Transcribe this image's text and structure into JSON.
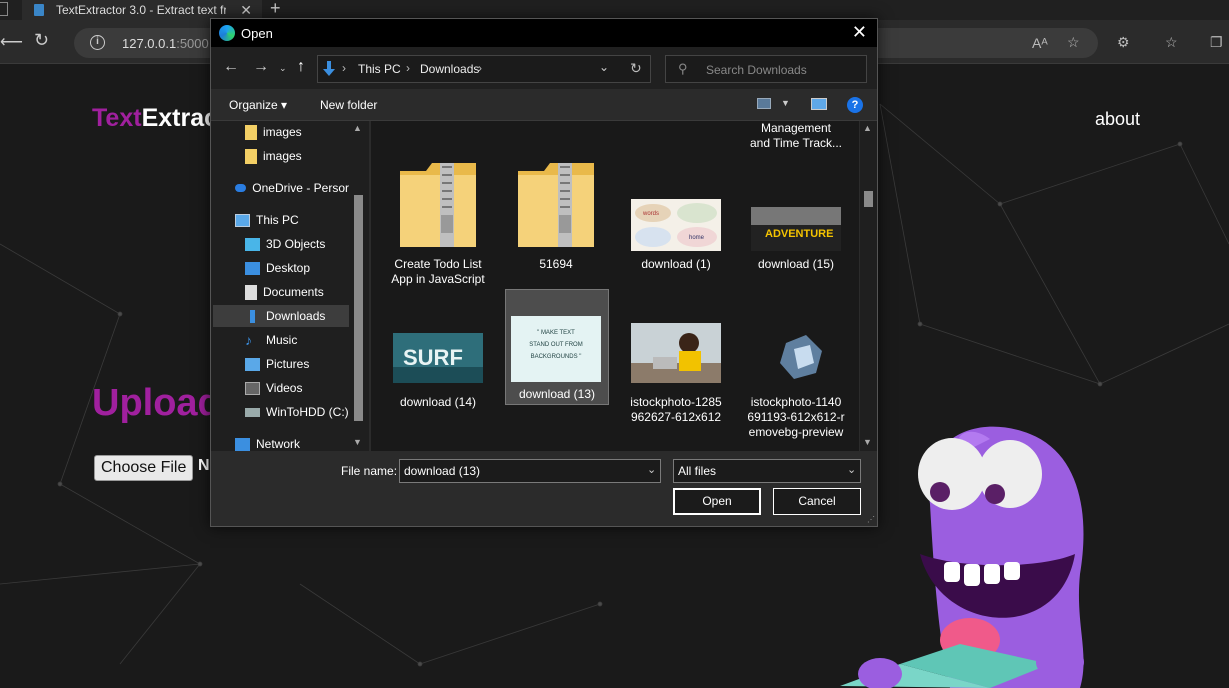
{
  "browser": {
    "tab_title": "TextExtractor 3.0 - Extract text fro",
    "tab_close": "✕",
    "new_tab": "+",
    "address_host": "127.0.0.1",
    "address_port": ":5000"
  },
  "page": {
    "brand_part1": "Text",
    "brand_part2": "Extrac",
    "nav_about": "about",
    "upload_heading": "Upload",
    "choose_file_label": "Choose File",
    "no_file_text": "N"
  },
  "dialog": {
    "title": "Open",
    "close": "✕",
    "breadcrumbs": [
      "This PC",
      "Downloads"
    ],
    "search_placeholder": "Search Downloads",
    "organize_label": "Organize ▾",
    "new_folder_label": "New folder",
    "help": "?",
    "nav_items": [
      {
        "label": "images",
        "icon": "folder-icon"
      },
      {
        "label": "images",
        "icon": "folder-icon"
      },
      {
        "label": "OneDrive - Persor",
        "icon": "onedrive-icon"
      },
      {
        "label": "This PC",
        "icon": "pc-icon"
      },
      {
        "label": "3D Objects",
        "icon": "3d-objects-icon"
      },
      {
        "label": "Desktop",
        "icon": "desktop-icon"
      },
      {
        "label": "Documents",
        "icon": "documents-icon"
      },
      {
        "label": "Downloads",
        "icon": "downloads-icon",
        "selected": true
      },
      {
        "label": "Music",
        "icon": "music-icon"
      },
      {
        "label": "Pictures",
        "icon": "pictures-icon"
      },
      {
        "label": "Videos",
        "icon": "videos-icon"
      },
      {
        "label": "WinToHDD (C:)",
        "icon": "drive-icon"
      },
      {
        "label": "Network",
        "icon": "network-icon"
      }
    ],
    "files_top_partial": "Management\nand Time Track...",
    "files": [
      {
        "name": "Create Todo List\nApp in JavaScript",
        "type": "zip"
      },
      {
        "name": "51694",
        "type": "zip"
      },
      {
        "name": "download (1)",
        "type": "image"
      },
      {
        "name": "download (15)",
        "type": "image",
        "thumb_text": "ADVENTURE"
      },
      {
        "name": "download (14)",
        "type": "image",
        "thumb_text": "SURF"
      },
      {
        "name": "download (13)",
        "type": "image",
        "selected": true,
        "thumb_text": "\" MAKE TEXT STAND OUT FROM BACKGROUNDS \""
      },
      {
        "name": "istockphoto-1285\n962627-612x612",
        "type": "image"
      },
      {
        "name": "istockphoto-1140\n691193-612x612-r\nemovebg-preview",
        "type": "image"
      }
    ],
    "file_name_label": "File name:",
    "file_name_value": "download (13)",
    "file_type_value": "All files",
    "open_label": "Open",
    "cancel_label": "Cancel"
  },
  "colors": {
    "brand_purple": "#a0209e",
    "dialog_bg": "#2b2b2b",
    "selection": "#4d4d4d",
    "accent_blue": "#1a73e8"
  }
}
